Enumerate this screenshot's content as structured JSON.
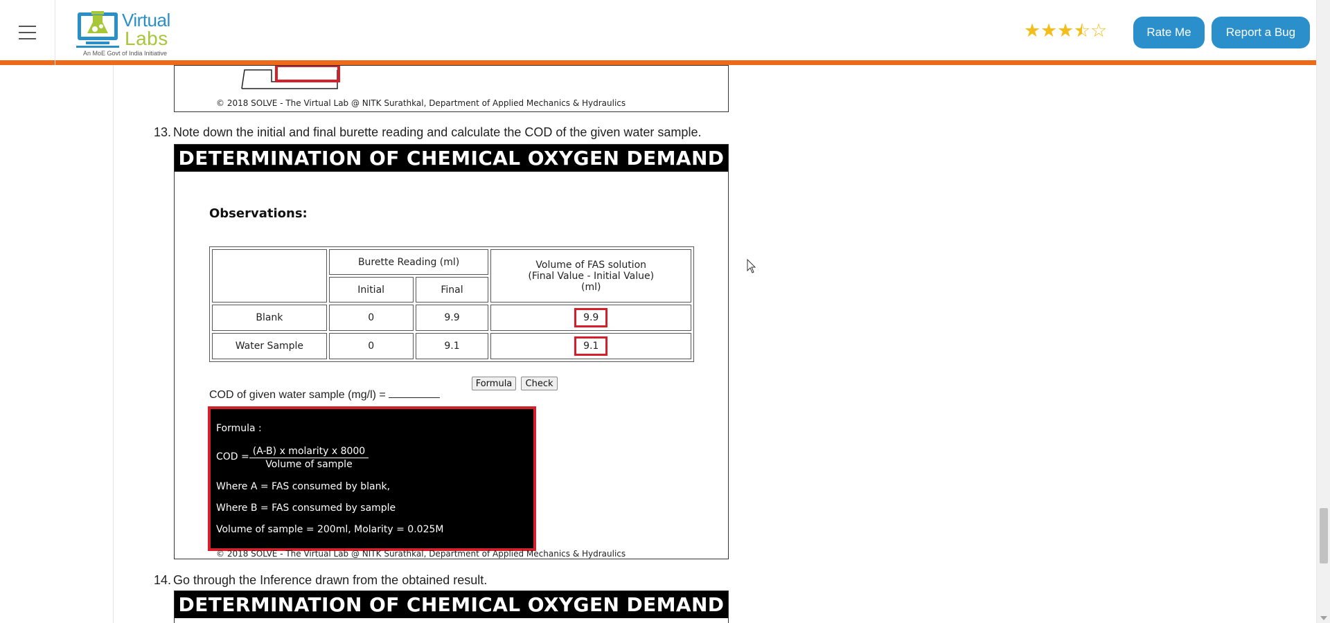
{
  "navbar": {
    "logo_word1": "Virtual",
    "logo_word2": "Labs",
    "logo_tagline": "An MoE Govt of India Initiative",
    "rating_label": "3.5 of 5 stars",
    "rating_value": 3.5,
    "rating_max": 5,
    "rate_button": "Rate Me",
    "bug_button": "Report a Bug",
    "accent_color": "#ee6a1b",
    "button_color": "#2b8fcb",
    "icons": [
      "menu-icon",
      "star-icon"
    ]
  },
  "copyright": "© 2018 SOLVE - The Virtual Lab @ NITK Surathkal, Department of Applied Mechanics & Hydraulics",
  "steps": [
    {
      "num": "13.",
      "text": "Note down the initial and final burette reading and calculate the COD of the given water sample."
    },
    {
      "num": "14.",
      "text": "Go through the Inference drawn from the obtained result."
    }
  ],
  "simulation": {
    "banner": "DETERMINATION OF CHEMICAL OXYGEN DEMAND",
    "observations_title": "Observations:",
    "table": {
      "header_burette": "Burette Reading (ml)",
      "header_initial": "Initial",
      "header_final": "Final",
      "header_volume_1": "Volume of FAS solution",
      "header_volume_2": "(Final Value - Initial Value)",
      "header_volume_3": "(ml)",
      "rows": [
        {
          "label": "Blank",
          "initial": "0",
          "final": "9.9",
          "volume": "9.9"
        },
        {
          "label": "Water Sample",
          "initial": "0",
          "final": "9.1",
          "volume": "9.1"
        }
      ]
    },
    "formula_button": "Formula",
    "check_button": "Check",
    "cod_label": "COD of given water sample (mg/l) =",
    "formula": {
      "title": "Formula :",
      "cod_prefix": "COD =",
      "numerator": "(A-B) x molarity x 8000",
      "denominator": "Volume of sample",
      "where_a": "Where A = FAS consumed by blank,",
      "where_b": "Where B = FAS consumed by sample",
      "volume_molarity": "Volume of sample = 200ml, Molarity = 0.025M"
    },
    "highlight_color": "#d3202a"
  }
}
